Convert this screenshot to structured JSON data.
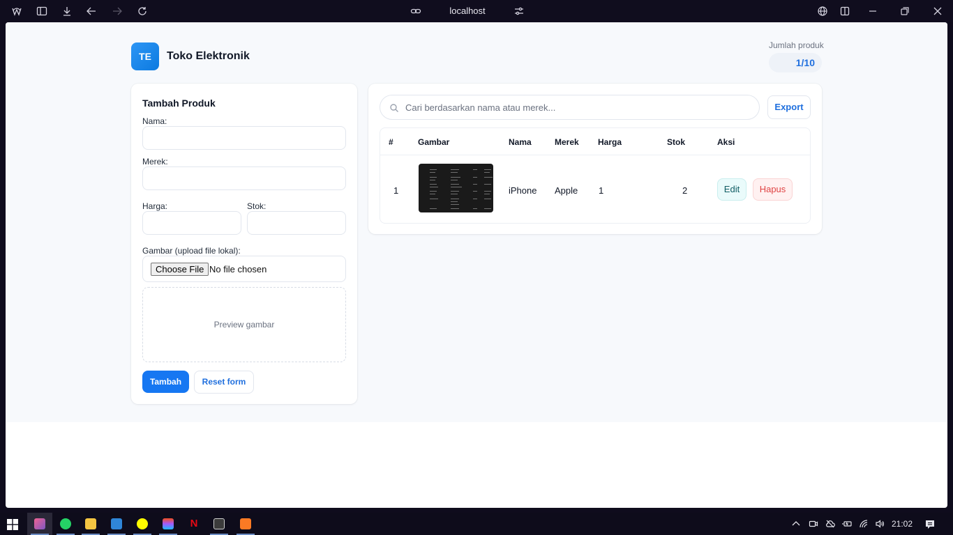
{
  "browser": {
    "url": "localhost"
  },
  "header": {
    "logo_text": "TE",
    "title": "Toko Elektronik",
    "count_label": "Jumlah produk",
    "count_value": "1/10"
  },
  "form": {
    "title": "Tambah Produk",
    "name_label": "Nama:",
    "brand_label": "Merek:",
    "price_label": "Harga:",
    "stock_label": "Stok:",
    "image_label": "Gambar (upload file lokal):",
    "file_button": "Choose File",
    "file_status": "No file chosen",
    "preview_text": "Preview gambar",
    "submit_label": "Tambah",
    "reset_label": "Reset form"
  },
  "search": {
    "placeholder": "Cari berdasarkan nama atau merek..."
  },
  "export_label": "Export",
  "table": {
    "columns": [
      "#",
      "Gambar",
      "Nama",
      "Merek",
      "Harga",
      "Stok",
      "Aksi"
    ],
    "rows": [
      {
        "no": "1",
        "name": "iPhone",
        "brand": "Apple",
        "price": "1",
        "stock": "2",
        "edit": "Edit",
        "delete": "Hapus"
      }
    ]
  },
  "taskbar": {
    "time": "21:02",
    "apps": [
      "start-icon",
      "browser-icon",
      "whatsapp-icon",
      "file-explorer-icon",
      "vscode-icon",
      "snapchat-icon",
      "figma-icon",
      "netflix-icon",
      "terminal-icon",
      "xampp-icon"
    ]
  },
  "colors": {
    "accent": "#1677f2",
    "danger": "#e04444",
    "edit": "#0f5c63",
    "page_bg": "#f7f9fc"
  }
}
